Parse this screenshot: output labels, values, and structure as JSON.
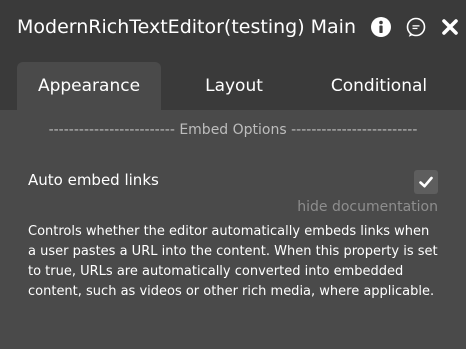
{
  "header": {
    "title": "ModernRichTextEditor(testing) Main",
    "icons": [
      "info-icon",
      "comment-icon",
      "close-icon"
    ]
  },
  "tabs": [
    {
      "label": "Appearance",
      "active": true
    },
    {
      "label": "Layout",
      "active": false
    },
    {
      "label": "Conditional",
      "active": false
    }
  ],
  "section": {
    "title": "------------------------- Embed Options -------------------------"
  },
  "property": {
    "label": "Auto embed links",
    "checked": true,
    "hide_doc_label": "hide documentation",
    "documentation": "Controls whether the editor automatically embeds links when a user pastes a URL into the content. When this property is set to true, URLs are automatically converted into embedded content, such as videos or other rich media, where applicable."
  },
  "colors": {
    "panel_bg": "#4a4a4a",
    "header_bg": "#3a3a3a",
    "muted_text": "#8e8e8e"
  }
}
